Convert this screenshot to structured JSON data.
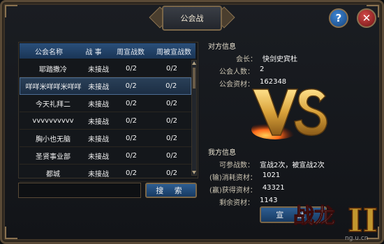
{
  "window": {
    "title": "公会战"
  },
  "buttons": {
    "help": "?",
    "close": "✕",
    "search": "搜 索",
    "declare": "宣 战"
  },
  "table": {
    "headers": [
      "公会名称",
      "战 事",
      "周宣战数",
      "周被宣战数"
    ],
    "rows": [
      {
        "name": "耶踏撒冷",
        "status": "未接战",
        "declared": "0/2",
        "received": "0/2"
      },
      {
        "name": "咩咩米咩咩米咩咩",
        "status": "未接战",
        "declared": "0/2",
        "received": "0/2"
      },
      {
        "name": "今天礼拜二",
        "status": "未接战",
        "declared": "0/2",
        "received": "0/2"
      },
      {
        "name": "vvvvvvvvvv",
        "status": "未接战",
        "declared": "0/2",
        "received": "0/2"
      },
      {
        "name": "胸小也无脑",
        "status": "未接战",
        "declared": "0/2",
        "received": "0/2"
      },
      {
        "name": "圣贤事业部",
        "status": "未接战",
        "declared": "0/2",
        "received": "0/2"
      },
      {
        "name": "都城",
        "status": "未接战",
        "declared": "0/2",
        "received": "0/2"
      }
    ],
    "selected_index": 1
  },
  "search": {
    "value": "",
    "placeholder": ""
  },
  "opponent": {
    "title": "对方信息",
    "leader_label": "会长：",
    "leader_value": "快剑史宾杜",
    "members_label": "公会人数：",
    "members_value": "2",
    "funds_label": "公会资材：",
    "funds_value": "162348"
  },
  "mine": {
    "title": "我方信息",
    "participations_label": "可参战数：",
    "participations_value": "宣战2次，被宣战2次",
    "lost_label": "(输)消耗资材：",
    "lost_value": "1021",
    "win_label": "(赢)获得资材：",
    "win_value": "43321",
    "remaining_label": "剩余资材：",
    "remaining_value": "1143"
  },
  "logo": {
    "text": "战龙",
    "numeral": "II",
    "watermark": "ng.u.cn"
  },
  "colors": {
    "accent_blue": "#2a4f7a",
    "gold": "#d9a23a",
    "frame": "#5a4a36"
  }
}
